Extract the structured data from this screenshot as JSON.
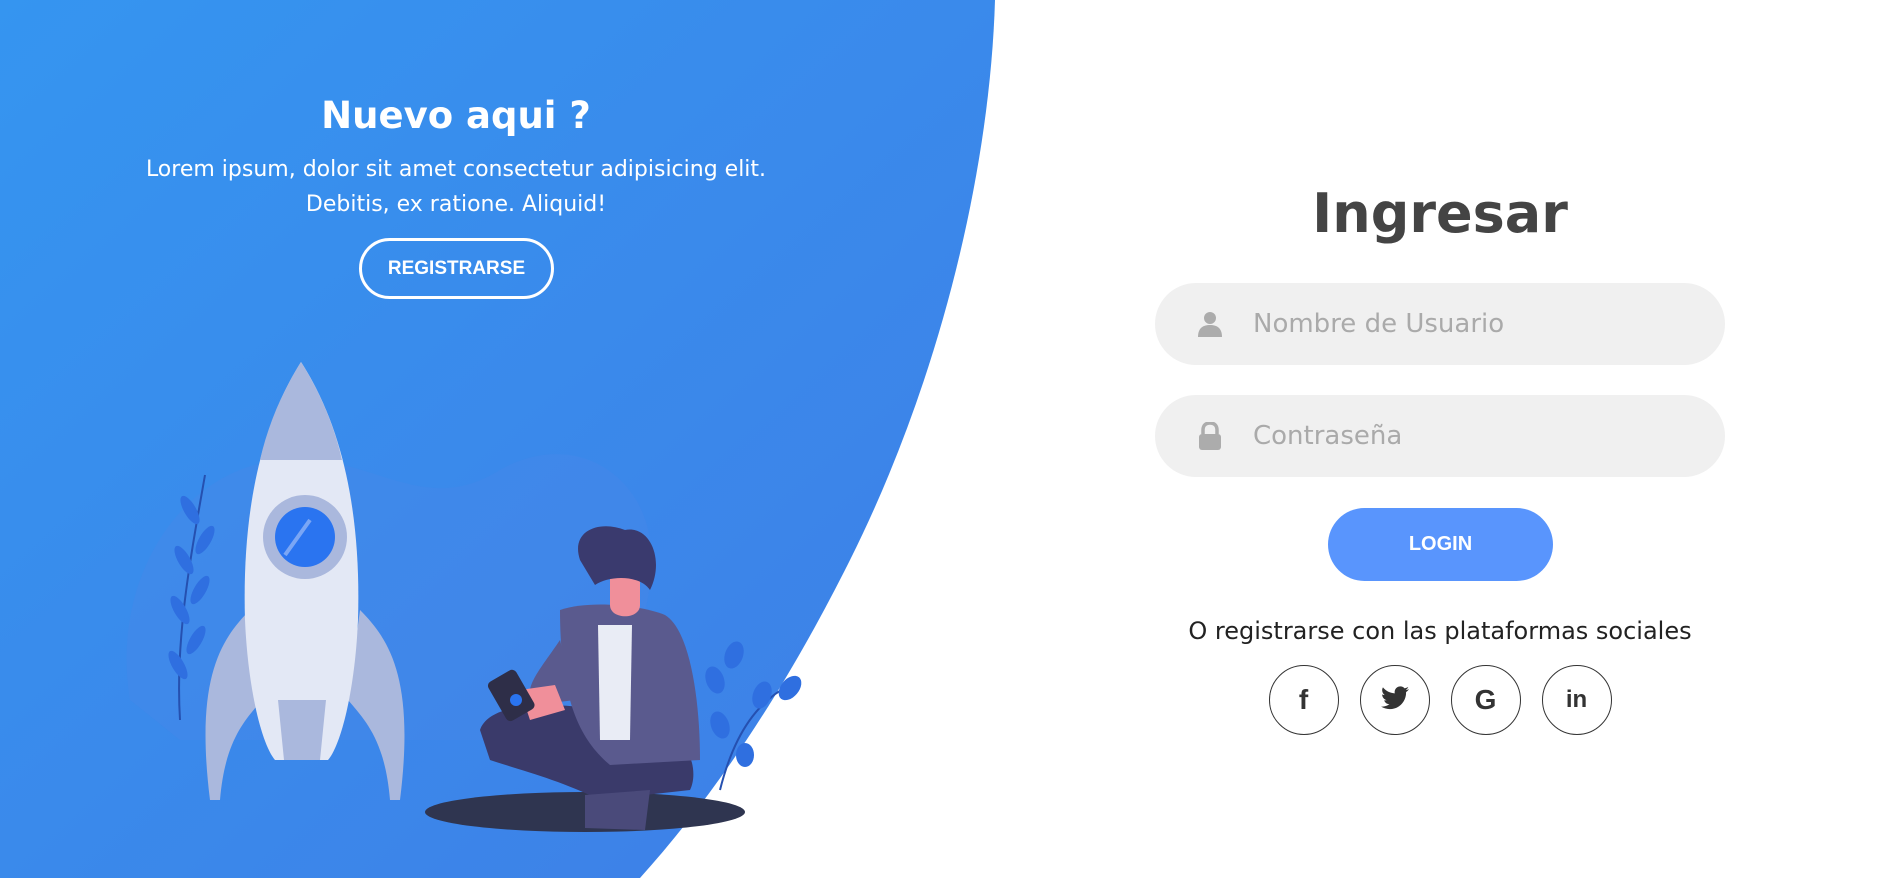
{
  "left": {
    "title": "Nuevo aqui ?",
    "description": "Lorem ipsum, dolor sit amet consectetur adipisicing elit. Debitis, ex ratione. Aliquid!",
    "register_button": "REGISTRARSE"
  },
  "login": {
    "title": "Ingresar",
    "username_placeholder": "Nombre de Usuario",
    "username_value": "",
    "password_placeholder": "Contraseña",
    "password_value": "",
    "login_button": "LOGIN",
    "social_text": "O registrarse con las plataformas sociales",
    "social": [
      {
        "icon": "facebook-icon",
        "glyph": "f"
      },
      {
        "icon": "twitter-icon",
        "glyph": ""
      },
      {
        "icon": "google-icon",
        "glyph": "G"
      },
      {
        "icon": "linkedin-icon",
        "glyph": "in"
      }
    ]
  },
  "colors": {
    "accent_blue": "#3a8cf0",
    "login_button": "#5995fd",
    "input_bg": "#f0f0f0",
    "title_text": "#444444"
  }
}
